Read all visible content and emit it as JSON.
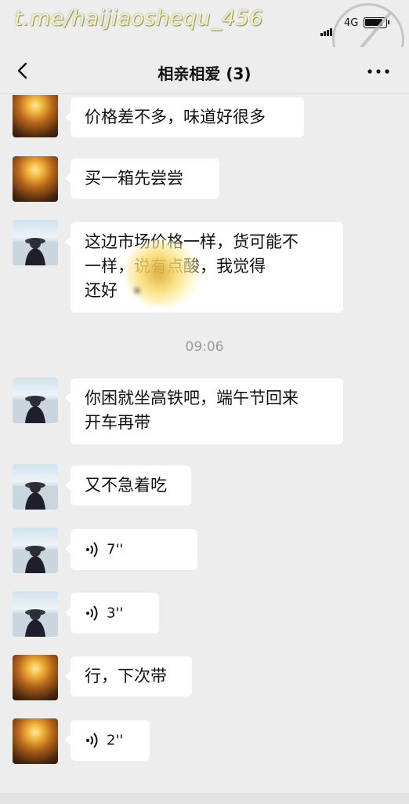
{
  "status_bar": {
    "watermark": "t.me/haijiaoshequ_456",
    "network": "4G"
  },
  "nav": {
    "title": "相亲相爱 (3)"
  },
  "messages": [
    {
      "type": "text",
      "avatar": "sunset-avatar",
      "text": "价格差不多，味道好很多"
    },
    {
      "type": "text",
      "avatar": "sunset-avatar",
      "text": "买一箱先尝尝"
    },
    {
      "type": "text",
      "avatar": "beach-avatar",
      "lines": [
        "这边市场价格一样，货可能不",
        "一样，说有点酸，我觉得",
        "还好"
      ]
    },
    {
      "type": "time",
      "text": "09:06"
    },
    {
      "type": "text",
      "avatar": "beach-avatar",
      "lines": [
        "你困就坐高铁吧，端午节回来",
        "开车再带"
      ]
    },
    {
      "type": "text",
      "avatar": "beach-avatar",
      "text": "又不急着吃"
    },
    {
      "type": "voice",
      "avatar": "beach-avatar",
      "duration": "7''"
    },
    {
      "type": "voice",
      "avatar": "beach-avatar",
      "duration": "3''"
    },
    {
      "type": "text",
      "avatar": "sunset-avatar",
      "text": "行，下次带"
    },
    {
      "type": "voice",
      "avatar": "sunset-avatar",
      "duration": "2''"
    }
  ],
  "icons": {
    "back": "chevron-left-icon",
    "more": "more-dots-icon",
    "voice": "voice-wave-icon"
  },
  "colors": {
    "background": "#ededed",
    "bubble": "#ffffff",
    "time_label": "#999999"
  }
}
